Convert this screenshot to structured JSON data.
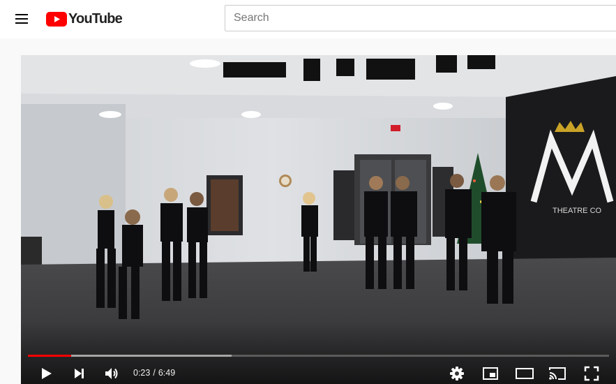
{
  "header": {
    "logo_text": "YouTube",
    "search_placeholder": "Search"
  },
  "player": {
    "current_time": "0:23",
    "time_separator": "/",
    "duration": "6:49",
    "progress_fraction": 0.074,
    "buffered_fraction": 0.35,
    "scene_sign_text": "THEATRE CO"
  },
  "colors": {
    "brand_red": "#ff0000",
    "progress_played": "#ff0000"
  },
  "icons": {
    "menu": "menu-icon",
    "play": "play-icon",
    "next": "next-icon",
    "volume": "volume-icon",
    "settings": "gear-icon",
    "miniplayer": "miniplayer-icon",
    "theater": "theater-mode-icon",
    "cast": "cast-icon",
    "fullscreen": "fullscreen-icon"
  }
}
